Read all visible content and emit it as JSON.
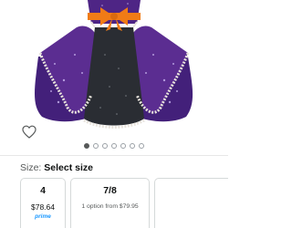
{
  "size_selector": {
    "label": "Size:",
    "value": "Select size"
  },
  "carousel": {
    "total": 7,
    "active_index": 0
  },
  "size_options": [
    {
      "size": "4",
      "price": "$78.64",
      "badge": "prime"
    },
    {
      "size": "7/8",
      "note": "1 option from $79.95"
    }
  ],
  "colors": {
    "dress_purple": "#5b2d91",
    "bow_orange": "#f07b16",
    "prime_blue": "#1a98ff",
    "tile_border": "#d5d9d9"
  },
  "icons": {
    "wishlist": "heart-outline-icon"
  }
}
